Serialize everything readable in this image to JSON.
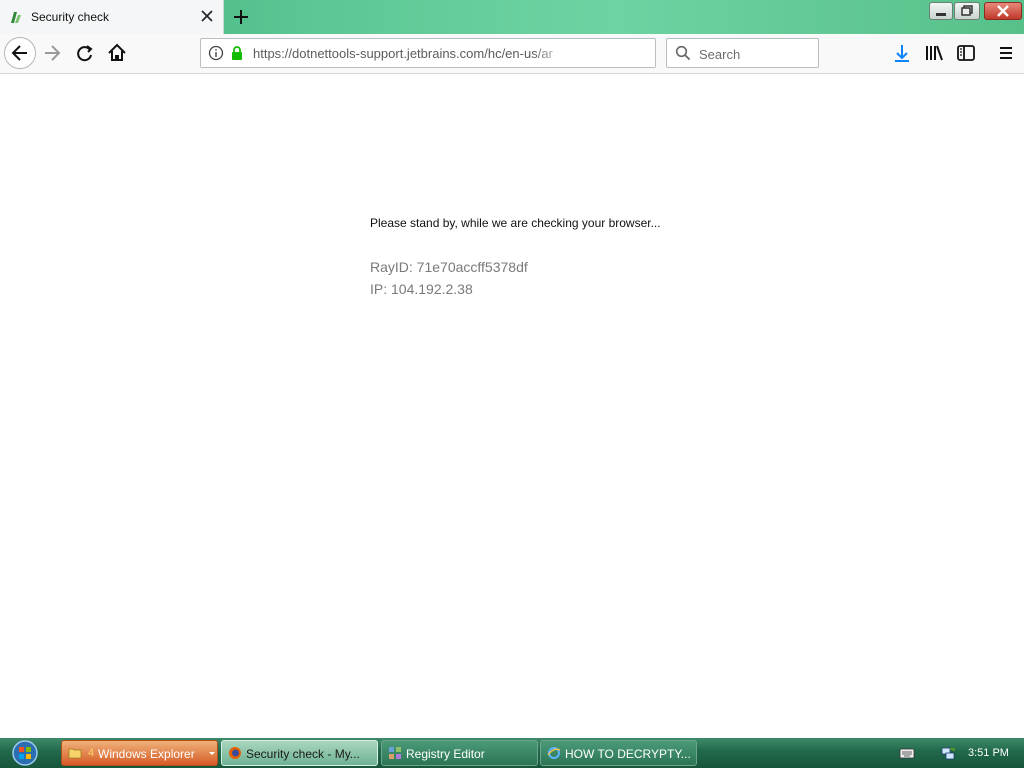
{
  "tab": {
    "title": "Security check"
  },
  "navbar": {
    "url": "https://dotnettools-support.jetbrains.com/hc/en-us/ar",
    "search_placeholder": "Search"
  },
  "page": {
    "message": "Please stand by, while we are checking your browser...",
    "ray_id": "RayID: 71e70accff5378df",
    "ip": "IP: 104.192.2.38"
  },
  "taskbar": {
    "items": [
      {
        "count": "4",
        "label": "Windows Explorer"
      },
      {
        "label": "Security check - My..."
      },
      {
        "label": "Registry Editor"
      },
      {
        "label": "HOW TO DECRYPTY..."
      }
    ],
    "clock": "3:51 PM"
  },
  "colors": {
    "titlebar_green": "#5bc794",
    "taskbar_green": "#21684b",
    "lock_green": "#12bc00",
    "download_blue": "#0a84ff"
  }
}
